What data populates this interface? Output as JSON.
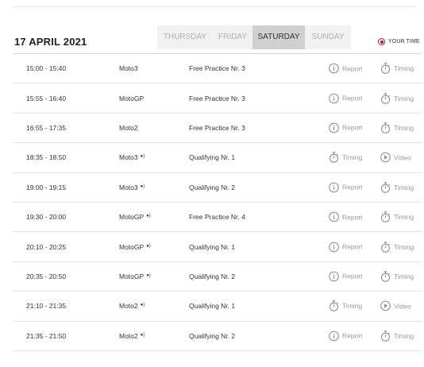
{
  "header": {
    "date": "17 APRIL 2021",
    "tabs": [
      {
        "label": "THURSDAY",
        "active": false
      },
      {
        "label": "FRIDAY",
        "active": false
      },
      {
        "label": "SATURDAY",
        "active": true
      },
      {
        "label": "SUNDAY",
        "active": false
      }
    ],
    "your_time": "YOUR TIME",
    "accent_color": "#c8102e"
  },
  "sessions": [
    {
      "time": "15:00 - 15:40",
      "category": "Moto3",
      "live": false,
      "session": "Free Practice Nr. 3",
      "actions": [
        {
          "label": "Report",
          "icon": "info-icon"
        },
        {
          "label": "Timing",
          "icon": "stopwatch-icon"
        }
      ]
    },
    {
      "time": "15:55 - 16:40",
      "category": "MotoGP",
      "live": false,
      "session": "Free Practice Nr. 3",
      "actions": [
        {
          "label": "Report",
          "icon": "info-icon"
        },
        {
          "label": "Timing",
          "icon": "stopwatch-icon"
        }
      ]
    },
    {
      "time": "16:55 - 17:35",
      "category": "Moto2",
      "live": false,
      "session": "Free Practice Nr. 3",
      "actions": [
        {
          "label": "Report",
          "icon": "info-icon"
        },
        {
          "label": "Timing",
          "icon": "stopwatch-icon"
        }
      ]
    },
    {
      "time": "18:35 - 18:50",
      "category": "Moto3",
      "live": true,
      "session": "Qualifying Nr. 1",
      "actions": [
        {
          "label": "Timing",
          "icon": "stopwatch-icon"
        },
        {
          "label": "Video",
          "icon": "play-icon"
        }
      ]
    },
    {
      "time": "19:00 - 19:15",
      "category": "Moto3",
      "live": true,
      "session": "Qualifying Nr. 2",
      "actions": [
        {
          "label": "Report",
          "icon": "info-icon"
        },
        {
          "label": "Timing",
          "icon": "stopwatch-icon"
        }
      ]
    },
    {
      "time": "19:30 - 20:00",
      "category": "MotoGP",
      "live": true,
      "session": "Free Practice Nr. 4",
      "actions": [
        {
          "label": "Report",
          "icon": "info-icon"
        },
        {
          "label": "Timing",
          "icon": "stopwatch-icon"
        }
      ]
    },
    {
      "time": "20:10 - 20:25",
      "category": "MotoGP",
      "live": true,
      "session": "Qualifying Nr. 1",
      "actions": [
        {
          "label": "Report",
          "icon": "info-icon"
        },
        {
          "label": "Timing",
          "icon": "stopwatch-icon"
        }
      ]
    },
    {
      "time": "20:35 - 20:50",
      "category": "MotoGP",
      "live": true,
      "session": "Qualifying Nr. 2",
      "actions": [
        {
          "label": "Report",
          "icon": "info-icon"
        },
        {
          "label": "Timing",
          "icon": "stopwatch-icon"
        }
      ]
    },
    {
      "time": "21:10 - 21:35",
      "category": "Moto2",
      "live": true,
      "session": "Qualifying Nr. 1",
      "actions": [
        {
          "label": "Timing",
          "icon": "stopwatch-icon"
        },
        {
          "label": "Video",
          "icon": "play-icon"
        }
      ]
    },
    {
      "time": "21:35 - 21:50",
      "category": "Moto2",
      "live": true,
      "session": "Qualifying Nr. 2",
      "actions": [
        {
          "label": "Report",
          "icon": "info-icon"
        },
        {
          "label": "Timing",
          "icon": "stopwatch-icon"
        }
      ]
    }
  ]
}
